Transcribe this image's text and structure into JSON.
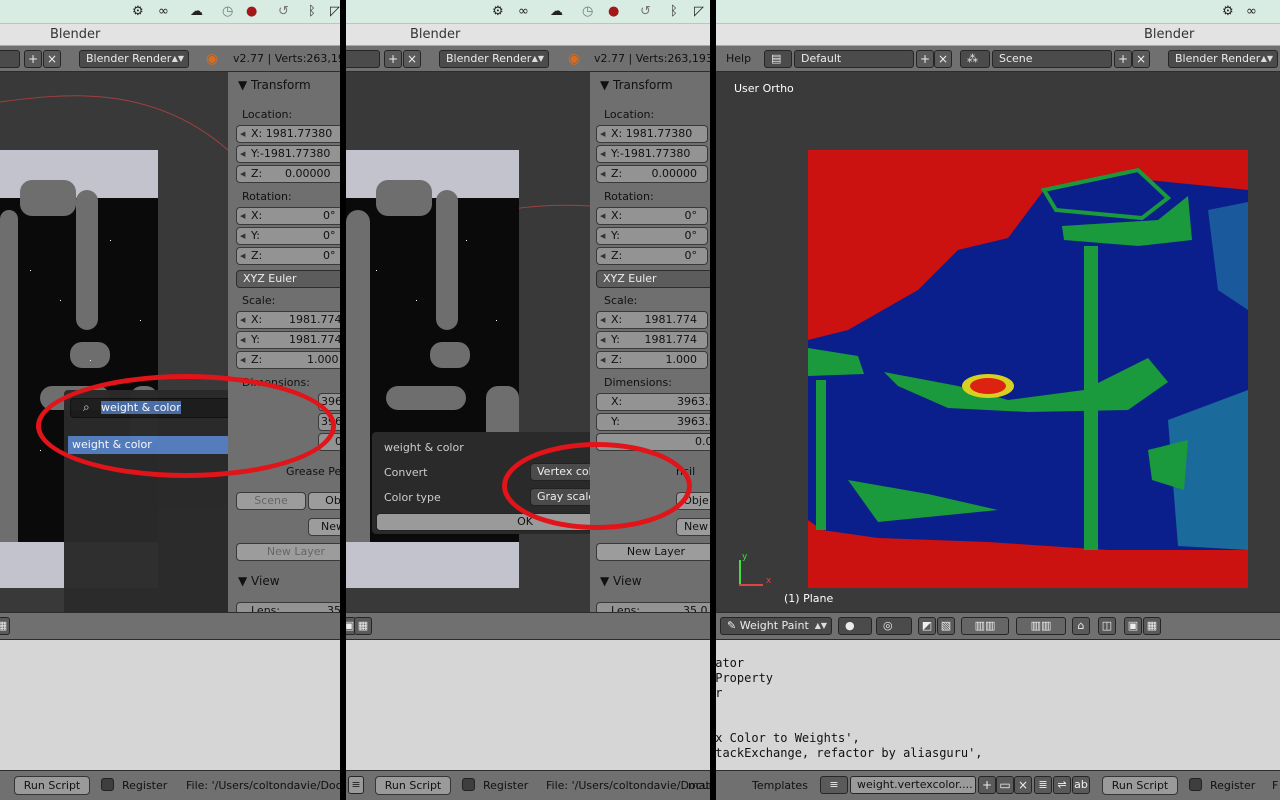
{
  "panels": {
    "left": {
      "window_title": "Blender",
      "header": {
        "render_engine": "Blender Render",
        "version_stats": "v2.77 | Verts:263,19"
      },
      "transform": {
        "title": "Transform",
        "location_label": "Location:",
        "loc_x": "X: 1981.77380",
        "loc_y": "Y:-1981.77380",
        "loc_z_key": "Z:",
        "loc_z_val": "0.00000",
        "rotation_label": "Rotation:",
        "rot_x_key": "X:",
        "rot_x_val": "0°",
        "rot_y_key": "Y:",
        "rot_y_val": "0°",
        "rot_z_key": "Z:",
        "rot_z_val": "0°",
        "euler": "XYZ Euler",
        "scale_label": "Scale:",
        "sc_x_key": "X:",
        "sc_x_val": "1981.774",
        "sc_y_key": "Y:",
        "sc_y_val": "1981.774",
        "sc_z_key": "Z:",
        "sc_z_val": "1.000",
        "dimensions_label": "Dimensions:",
        "dim_x_val": "3963",
        "dim_y_val": "396",
        "dim_z_val": "0.",
        "grease_pencil": "Grease Penc",
        "obj_tab": "Ob",
        "scene_tab": "Scene",
        "new_btn": "New",
        "new_layer": "New Layer",
        "view_title": "View",
        "lens_label": "Lens:",
        "lens_val": "35"
      },
      "search": {
        "query": "weight & color",
        "result": "weight & color"
      },
      "footer": {
        "run_script": "Run Script",
        "register": "Register",
        "file_path": "File: '/Users/coltondavie/Docum"
      }
    },
    "middle": {
      "window_title": "Blender",
      "header": {
        "render_engine": "Blender Render",
        "version_stats": "v2.77 | Verts:263,193"
      },
      "transform": {
        "title": "Transform",
        "location_label": "Location:",
        "loc_x": "X: 1981.77380",
        "loc_y": "Y:-1981.77380",
        "loc_z_key": "Z:",
        "loc_z_val": "0.00000",
        "rotation_label": "Rotation:",
        "rot_x_key": "X:",
        "rot_x_val": "0°",
        "rot_y_key": "Y:",
        "rot_y_val": "0°",
        "rot_z_key": "Z:",
        "rot_z_val": "0°",
        "euler": "XYZ Euler",
        "scale_label": "Scale:",
        "sc_x_key": "X:",
        "sc_x_val": "1981.774",
        "sc_y_key": "Y:",
        "sc_y_val": "1981.774",
        "sc_z_key": "Z:",
        "sc_z_val": "1.000",
        "dimensions_label": "Dimensions:",
        "dim_x_key": "X:",
        "dim_x_val": "3963.5",
        "dim_y_key": "Y:",
        "dim_y_val": "3963.5",
        "dim_z_val": "0.0",
        "grease_pencil": "ncil",
        "obj_tab": "Obje",
        "new_btn": "New",
        "new_layer": "New Layer",
        "view_title": "View",
        "lens_label": "Lens:",
        "lens_val": "35.0"
      },
      "dialog": {
        "title": "weight & color",
        "convert_label": "Convert",
        "convert_value": "Vertex color to weight",
        "color_type_label": "Color type",
        "color_type_value": "Gray scale",
        "ok": "OK"
      },
      "footer": {
        "run_script": "Run Script",
        "register": "Register",
        "file_path": "File: '/Users/coltondavie/Docume",
        "trailing": "mat"
      }
    },
    "right": {
      "window_title": "Blender",
      "header": {
        "help": "Help",
        "layout": "Default",
        "scene": "Scene",
        "render_engine": "Blender Render"
      },
      "viewport": {
        "view_name": "User Ortho",
        "object_name": "(1) Plane",
        "axis_y": "y",
        "axis_x": "x"
      },
      "mode": "Weight Paint",
      "text_lines": [
        "rator",
        "rProperty",
        "or",
        "",
        "ex Color to Weights',",
        "StackExchange, refactor by aliasguru',"
      ],
      "footer": {
        "templates": "Templates",
        "text_name": "weight.vertexcolor....",
        "run_script": "Run Script",
        "register": "Register",
        "trailing": "F"
      }
    }
  },
  "colors": {
    "annotation_red": "#e1141a",
    "weight_red": "#cc1111",
    "weight_blue": "#0a1f8c",
    "weight_green": "#1a9a3c"
  },
  "icons": [
    "bluetooth-icon",
    "wifi-icon",
    "infinity-icon",
    "time-machine-icon",
    "search-icon",
    "blender-logo-icon"
  ]
}
